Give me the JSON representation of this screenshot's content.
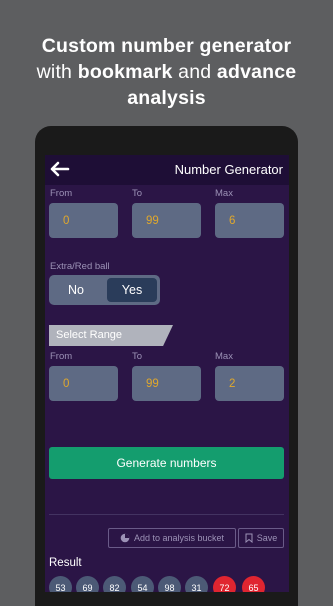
{
  "promo": {
    "line1": "Custom number generator",
    "line2_pre": "with ",
    "line2_bold1": "bookmark",
    "line2_mid": " and ",
    "line2_bold2": "advance",
    "line3": "analysis"
  },
  "appbar": {
    "title": "Number Generator",
    "back_icon": "arrow-left-icon"
  },
  "range1": {
    "from_label": "From",
    "to_label": "To",
    "max_label": "Max",
    "from_value": "0",
    "to_value": "99",
    "max_value": "6"
  },
  "extra": {
    "label": "Extra/Red ball",
    "no": "No",
    "yes": "Yes",
    "selected": "Yes"
  },
  "select_range": {
    "label": "Select Range"
  },
  "range2": {
    "from_label": "From",
    "to_label": "To",
    "max_label": "Max",
    "from_value": "0",
    "to_value": "99",
    "max_value": "2"
  },
  "generate_label": "Generate numbers",
  "actions": {
    "analysis": "Add to analysis bucket",
    "analysis_icon": "pie-chart-icon",
    "save": "Save",
    "save_icon": "bookmark-icon"
  },
  "result": {
    "label": "Result",
    "numbers": [
      "53",
      "69",
      "82",
      "54",
      "98",
      "31"
    ],
    "extra_numbers": [
      "72",
      "65"
    ]
  },
  "colors": {
    "accent_green": "#149d6e",
    "ball_red": "#e02530",
    "value_gold": "#e0a82c",
    "background": "#2b1546"
  }
}
